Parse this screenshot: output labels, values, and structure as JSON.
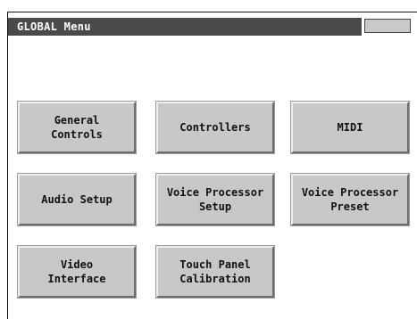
{
  "window": {
    "title": "GLOBAL Menu"
  },
  "menu": {
    "buttons": [
      {
        "label": "General\nControls"
      },
      {
        "label": "Controllers"
      },
      {
        "label": "MIDI"
      },
      {
        "label": "Audio Setup"
      },
      {
        "label": "Voice Processor\nSetup"
      },
      {
        "label": "Voice Processor\nPreset"
      },
      {
        "label": "Video\nInterface"
      },
      {
        "label": "Touch Panel\nCalibration"
      }
    ]
  },
  "colors": {
    "title_bar": "#4a4a4a",
    "button_face": "#c8c8c8",
    "background": "#ffffff"
  }
}
